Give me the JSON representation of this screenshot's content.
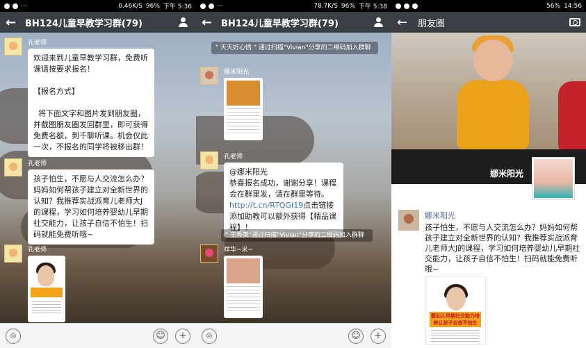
{
  "panel1": {
    "status": {
      "speed": "0.46K/S",
      "battery": "96%",
      "time": "下午 5:36"
    },
    "header": {
      "title": "BH124儿童早教学习群(79)"
    },
    "messages": [
      {
        "sender": "孔老师",
        "text": "欢迎来到儿童早教学习群，免费听课请按要求报名！\n\n【报名方式】\n\n  将下面文字和图片发到朋友圈，并截图朋友圈发回群里，即可获得免费名额，到千聊听课。机会仅此一次，不报名的同学将被移出群！"
      },
      {
        "sender": "孔老师",
        "text": "孩子怕生，不愿与人交流怎么办？妈妈如何帮孩子建立对全新世界的认知？我推荐实战派育儿老师大J的课程，学习如何培养婴幼儿早期社交能力，让孩子自信不怕生！扫码就能免费听哦~"
      },
      {
        "sender": "孔老师"
      }
    ]
  },
  "panel2": {
    "status": {
      "speed": "78.7K/S",
      "battery": "96%",
      "time": "下午 5:38"
    },
    "header": {
      "title": "BH124儿童早教学习群(79)"
    },
    "system1": "\" 天天好心情 \" 通过扫描\"Vivian\"分享的二维码加入群聊",
    "sender1": "娜米阳光",
    "sender2": "孔老师",
    "reply": {
      "mention": "@娜米阳光",
      "text": "恭喜报名成功，谢谢分享！课程会在群里发，请在群里等待。",
      "link": "http://t.cn/RTQGI19",
      "text2": "点击链接添加助教可以额外获得【精品课程】！"
    },
    "system2": "\" 王秀英\"通过扫描\"Vivian\"分享的二维码加入群聊",
    "sender3": "样华~米~"
  },
  "panel3": {
    "status": {
      "battery": "56%",
      "time": "14:56"
    },
    "header": {
      "title": "朋友圈"
    },
    "cover_name": "娜米阳光",
    "post": {
      "name": "娜米阳光",
      "text": "孩子怕生，不愿与人交流怎么办？妈妈如何帮孩子建立对全新世界的认知？我推荐实战派育儿老师大J的课程，学习如何培养婴幼儿早期社交能力，让孩子自信不怕生！扫码就能免费听哦~",
      "image_text": "婴幼儿早期社交能力培养让孩子自信不怕生"
    }
  }
}
